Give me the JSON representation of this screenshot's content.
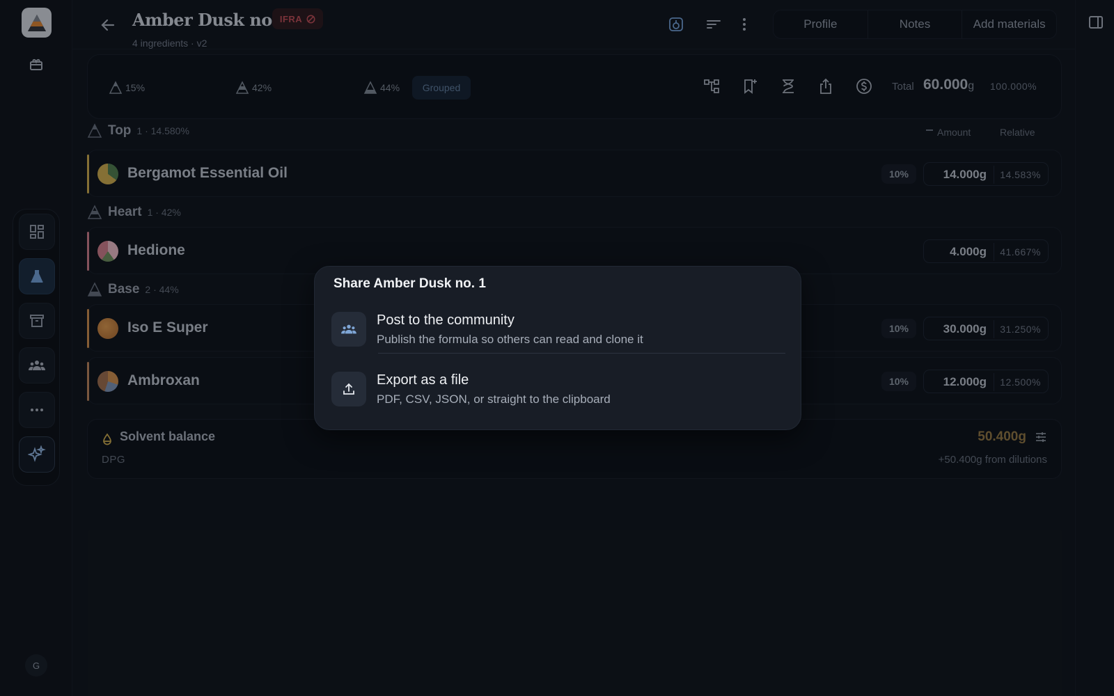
{
  "app": {
    "title": "Amber Dusk no. 1",
    "badge": "IFRA",
    "subtitle": "4 ingredients · v2",
    "tabs": [
      "Profile",
      "Notes",
      "Add materials"
    ],
    "avatar_initial": "G",
    "icons": {
      "logo": "pyramid-logo",
      "back": "arrow-left-icon",
      "header": [
        "bottle-icon",
        "sort-icon",
        "more-vertical-icon"
      ],
      "summary": [
        "hierarchy-icon",
        "bookmark-plus-icon",
        "hourglass-icon",
        "share-icon",
        "dollar-icon"
      ],
      "rail": [
        "dashboard-icon",
        "flask-icon",
        "archive-icon",
        "community-icon",
        "more-horizontal-icon",
        "sparkle-icon"
      ]
    }
  },
  "summary": {
    "pyramid": [
      "15%",
      "42%",
      "44%"
    ],
    "grouped_label": "Grouped",
    "total_label": "Total",
    "total_value": "60.000",
    "total_unit": "g",
    "total_pct": "100.000%"
  },
  "columns": {
    "amount": "Amount",
    "relative": "Relative"
  },
  "groups": [
    {
      "name": "Top",
      "meta": "1 · 14.580%"
    },
    {
      "name": "Heart",
      "meta": "1 · 42%"
    },
    {
      "name": "Base",
      "meta": "2 · 44%"
    }
  ],
  "ingredients": [
    {
      "name": "Bergamot Essential Oil",
      "dilution": "10%",
      "amount": "14.000g",
      "relative": "14.583%",
      "accent": "#c9a84a"
    },
    {
      "name": "Hedione",
      "dilution": "",
      "amount": "4.000g",
      "relative": "41.667%",
      "accent": "#c97a86"
    },
    {
      "name": "Iso E Super",
      "dilution": "10%",
      "amount": "30.000g",
      "relative": "31.250%",
      "accent": "#c98a4a"
    },
    {
      "name": "Ambroxan",
      "dilution": "10%",
      "amount": "12.000g",
      "relative": "12.500%",
      "accent": "#b8825a"
    }
  ],
  "solvent": {
    "label": "Solvent balance",
    "name": "DPG",
    "value": "50.400g",
    "note": "+50.400g from dilutions"
  },
  "dialog": {
    "title": "Share Amber Dusk no. 1",
    "options": [
      {
        "title": "Post to the community",
        "description": "Publish the formula so others can read and clone it",
        "icon": "community-icon"
      },
      {
        "title": "Export as a file",
        "description": "PDF, CSV, JSON, or straight to the clipboard",
        "icon": "upload-icon"
      }
    ]
  }
}
